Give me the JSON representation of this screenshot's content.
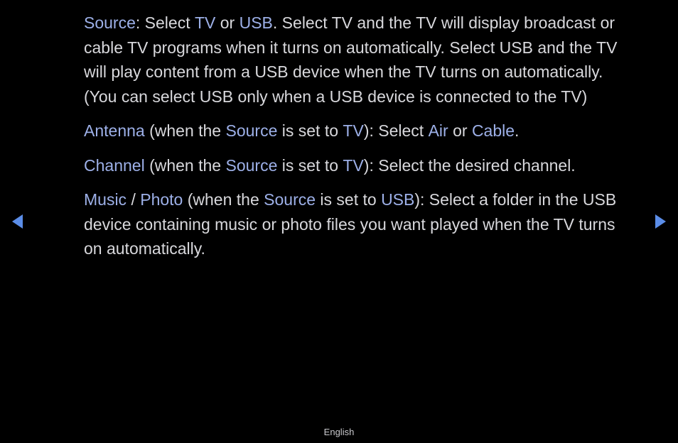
{
  "p1": {
    "s0": "Source",
    "t0": ": Select ",
    "s1": "TV",
    "t1": " or ",
    "s2": "USB",
    "t2": ". Select TV and the TV will display broadcast or cable TV programs when it turns on automatically. Select USB and the TV will play content from a USB device when the TV turns on automatically. (You can select USB only when a USB device is connected to the TV)"
  },
  "p2": {
    "s0": "Antenna",
    "t0": " (when the ",
    "s1": "Source",
    "t1": " is set to ",
    "s2": "TV",
    "t2": "): Select ",
    "s3": "Air",
    "t3": " or ",
    "s4": "Cable",
    "t4": "."
  },
  "p3": {
    "s0": "Channel",
    "t0": " (when the ",
    "s1": "Source",
    "t1": " is set to ",
    "s2": "TV",
    "t2": "): Select the desired channel."
  },
  "p4": {
    "s0": "Music",
    "t0": " / ",
    "s1": "Photo",
    "t1": " (when the ",
    "s2": "Source",
    "t2": " is set to ",
    "s3": "USB",
    "t3": "): Select a folder in the USB device containing music or photo files you want played when the TV turns on automatically."
  },
  "footer": "English"
}
